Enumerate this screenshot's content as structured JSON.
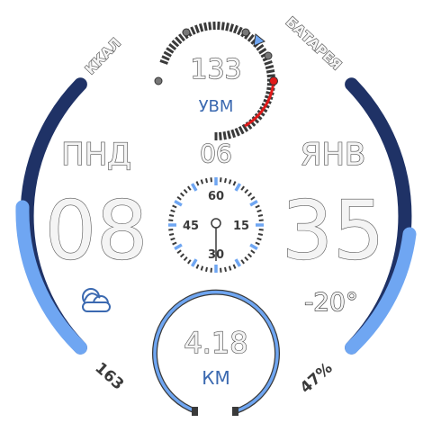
{
  "face": {
    "heart_rate": {
      "value": "133",
      "unit": "УВМ"
    },
    "date": {
      "weekday": "ПНД",
      "day": "06",
      "month": "ЯНВ"
    },
    "time": {
      "hours": "08",
      "minutes": "35"
    },
    "dial": {
      "labels": [
        "60",
        "15",
        "30",
        "45"
      ]
    },
    "calories": {
      "label": "ККАЛ",
      "value": "163",
      "progress": 0.55
    },
    "battery": {
      "label": "БАТАРЕЯ",
      "value": "47%",
      "progress": 0.47
    },
    "weather": {
      "icon": "cloud-icon",
      "temperature": "-20°"
    },
    "distance": {
      "value": "4.18",
      "unit": "КМ"
    }
  },
  "colors": {
    "track_dark": "#1f3266",
    "progress_light": "#6fa6f2",
    "heart_accent": "#e01b1b",
    "text_blue": "#3b69b0"
  }
}
